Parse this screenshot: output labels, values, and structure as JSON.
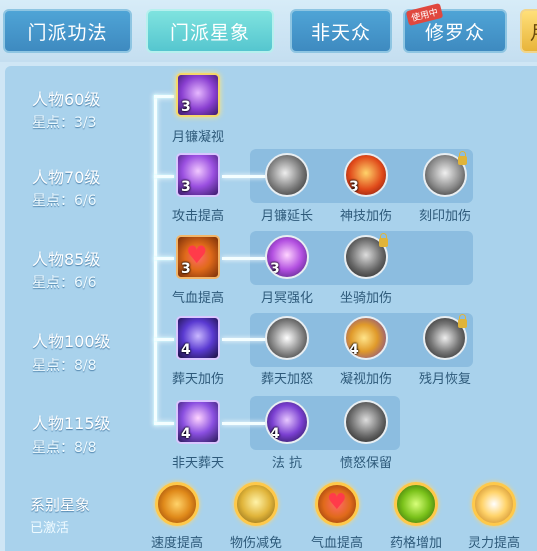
{
  "tabs": [
    {
      "label": "门派功法"
    },
    {
      "label": "门派星象"
    },
    {
      "label": "非天众"
    },
    {
      "label": "修罗众",
      "badge": "使用中"
    },
    {
      "label": "月"
    }
  ],
  "levels": [
    {
      "level": "人物60级",
      "stars": "星点：3/3"
    },
    {
      "level": "人物70级",
      "stars": "星点：6/6"
    },
    {
      "level": "人物85级",
      "stars": "星点：6/6"
    },
    {
      "level": "人物100级",
      "stars": "星点：8/8"
    },
    {
      "level": "人物115级",
      "stars": "星点：8/8"
    }
  ],
  "nodes": {
    "r1": [
      {
        "name": "月镰凝视",
        "count": "3",
        "icon": "sickle-gaze-icon"
      }
    ],
    "r2": [
      {
        "name": "攻击提高",
        "count": "3",
        "icon": "attack-up-icon"
      },
      {
        "name": "月镰延长",
        "count": "",
        "icon": "sickle-extend-icon"
      },
      {
        "name": "神技加伤",
        "count": "3",
        "icon": "divine-skill-icon"
      },
      {
        "name": "刻印加伤",
        "count": "",
        "icon": "imprint-icon"
      }
    ],
    "r3": [
      {
        "name": "气血提高",
        "count": "3",
        "icon": "heart-icon"
      },
      {
        "name": "月冥强化",
        "count": "3",
        "icon": "moon-orb-icon"
      },
      {
        "name": "坐骑加伤",
        "count": "",
        "icon": "mount-icon"
      }
    ],
    "r4": [
      {
        "name": "葬天加伤",
        "count": "4",
        "icon": "burial-icon"
      },
      {
        "name": "葬天加怒",
        "count": "",
        "icon": "rage-icon"
      },
      {
        "name": "凝视加伤",
        "count": "4",
        "icon": "crescent-icon"
      },
      {
        "name": "残月恢复",
        "count": "",
        "icon": "waning-moon-icon"
      }
    ],
    "r5": [
      {
        "name": "非天葬天",
        "count": "4",
        "icon": "asura-icon"
      },
      {
        "name": "法 抗",
        "count": "4",
        "icon": "demon-icon"
      },
      {
        "name": "愤怒保留",
        "count": "",
        "icon": "demon-mask-icon"
      }
    ]
  },
  "system": {
    "title": "系别星象",
    "status": "已激活",
    "items": [
      {
        "name": "速度提高",
        "icon": "speed-icon"
      },
      {
        "name": "物伤减免",
        "icon": "defense-icon"
      },
      {
        "name": "气血提高",
        "icon": "heart-icon"
      },
      {
        "name": "药格增加",
        "icon": "potion-icon"
      },
      {
        "name": "灵力提高",
        "icon": "spirit-icon"
      }
    ]
  },
  "colors": {
    "accent": "#55c6cf",
    "tab_blue": "#3e8ac0",
    "panel": "#a9d2ec"
  }
}
